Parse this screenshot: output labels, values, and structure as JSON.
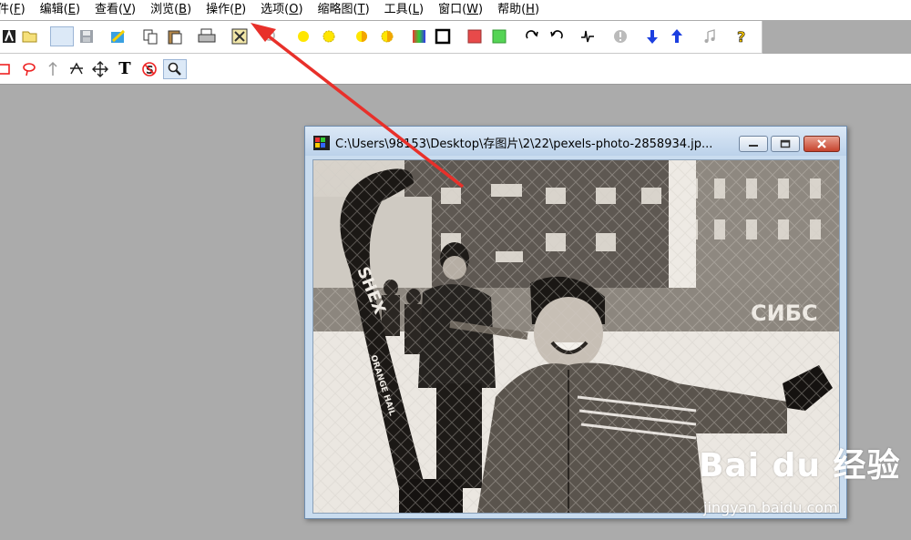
{
  "menu": {
    "items": [
      {
        "label": "件(",
        "key": "F",
        "suffix": ")"
      },
      {
        "label": "编辑(",
        "key": "E",
        "suffix": ")"
      },
      {
        "label": "查看(",
        "key": "V",
        "suffix": ")"
      },
      {
        "label": "浏览(",
        "key": "B",
        "suffix": ")"
      },
      {
        "label": "操作(",
        "key": "P",
        "suffix": ")"
      },
      {
        "label": "选项(",
        "key": "O",
        "suffix": ")"
      },
      {
        "label": "缩略图(",
        "key": "T",
        "suffix": ")"
      },
      {
        "label": "工具(",
        "key": "L",
        "suffix": ")"
      },
      {
        "label": "窗口(",
        "key": "W",
        "suffix": ")"
      },
      {
        "label": "帮助(",
        "key": "H",
        "suffix": ")"
      }
    ]
  },
  "toolbar1": {
    "icons": [
      "acdsee-icon",
      "open-folder-icon",
      "blank-icon",
      "save-icon",
      "edit-image-icon",
      "copy-icon",
      "paste-icon",
      "print-icon",
      "fit-window-icon",
      "zoom-icon",
      "brightness-up-icon",
      "brightness-down-icon",
      "contrast-up-icon",
      "contrast-down-icon",
      "color-balance-icon",
      "border-icon",
      "red-fill-icon",
      "green-fill-icon",
      "rotate-right-icon",
      "rotate-left-icon",
      "histogram-icon",
      "info-icon",
      "arrow-down-icon",
      "arrow-up-icon",
      "music-icon",
      "help-icon"
    ]
  },
  "toolbar2": {
    "icons": [
      "rectangle-select-icon",
      "lasso-icon",
      "pointer-arrow-icon",
      "star-crop-icon",
      "move-icon",
      "text-tool-icon",
      "stamp-icon",
      "magnifier-icon"
    ],
    "text_tool_label": "T"
  },
  "image_window": {
    "title": "C:\\Users\\98153\\Desktop\\存图片\\2\\22\\pexels-photo-2858934.jp...",
    "photo_caption_text": "СИБС",
    "stick_text": "SHEX",
    "stick_text2": "ORANGE HAIL"
  },
  "watermark": {
    "logo": "Bai du 经验",
    "url": "jingyan.baidu.com"
  },
  "colors": {
    "arrow": "#e8302a",
    "background": "#ababab",
    "toolbar_bg": "#ffffff"
  }
}
